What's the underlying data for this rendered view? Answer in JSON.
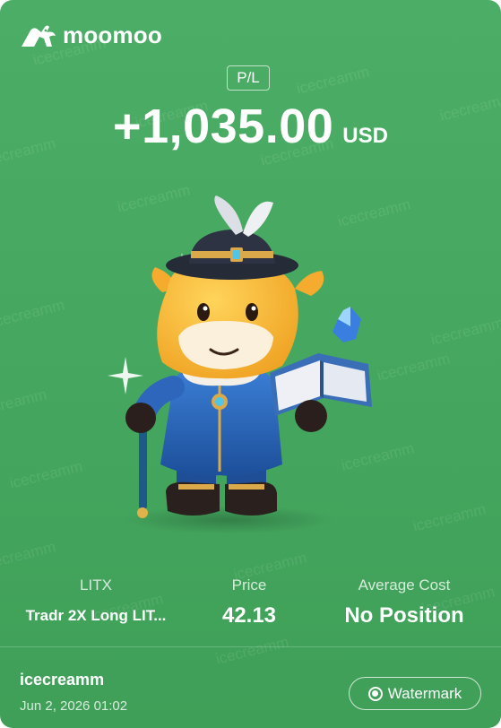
{
  "brand": {
    "name": "moomoo",
    "logo_icon": "bull-logo-icon"
  },
  "badge": {
    "label": "P/L"
  },
  "pnl": {
    "value": "+1,035.00",
    "currency": "USD"
  },
  "mascot": {
    "icon": "bull-mascot-illustration"
  },
  "watermark_text": "icecreamm",
  "stats": {
    "symbol": {
      "label": "LITX",
      "value": "Tradr 2X Long LIT..."
    },
    "price": {
      "label": "Price",
      "value": "42.13"
    },
    "average_cost": {
      "label": "Average Cost",
      "value": "No Position"
    }
  },
  "footer": {
    "username": "icecreamm",
    "datetime": "Jun 2, 2026 01:02",
    "watermark_button": {
      "label": "Watermark",
      "icon": "radio-checked-icon"
    }
  },
  "colors": {
    "background": "#47a860",
    "text": "#ffffff"
  }
}
